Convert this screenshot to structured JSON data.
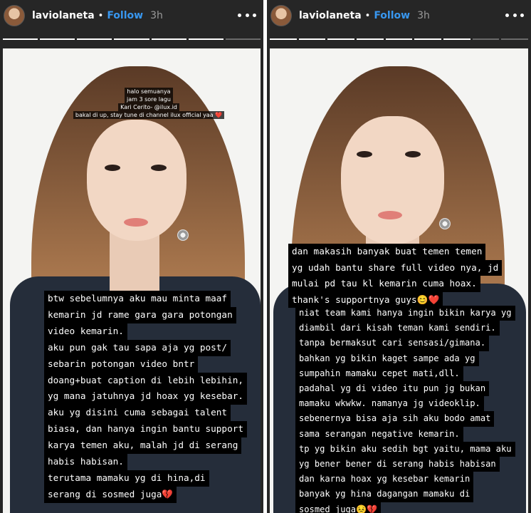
{
  "stories": [
    {
      "user": {
        "username": "laviolaneta",
        "follow_label": "Follow",
        "time": "3h"
      },
      "progress": {
        "total_segments": 7,
        "completed_segments": 6
      },
      "caption_lines": [
        "halo semuanya",
        "jam 3 sore lagu",
        "Kari Cerito- @ilux.id",
        "bakal di up, stay tune di channel ilux official yaa ❤️"
      ],
      "text_lines": [
        "btw sebelumnya aku mau minta maaf",
        "kemarin jd rame gara gara potongan",
        "video kemarin.",
        "aku pun gak tau sapa aja yg post/",
        "sebarin potongan video bntr",
        "doang+buat caption di lebih lebihin,",
        "yg mana jatuhnya jd hoax yg kesebar.",
        "aku yg disini cuma sebagai talent",
        "biasa, dan hanya ingin bantu support",
        "karya temen aku, malah jd di serang",
        "habis habisan.",
        "terutama mamaku yg di hina,di",
        "serang di sosmed juga💔"
      ]
    },
    {
      "user": {
        "username": "laviolaneta",
        "follow_label": "Follow",
        "time": "3h"
      },
      "progress": {
        "total_segments": 9,
        "completed_segments": 7
      },
      "text_lines_top": [
        "dan makasih banyak buat temen temen",
        "yg udah bantu share full video nya, jd",
        "mulai pd tau kl kemarin cuma hoax.",
        "thank's supportnya guys😊❤️"
      ],
      "text_lines": [
        "niat team kami hanya ingin bikin karya yg",
        "diambil dari kisah teman kami sendiri.",
        "tanpa bermaksut cari sensasi/gimana.",
        "bahkan yg bikin kaget sampe ada yg",
        "sumpahin mamaku cepet mati,dll.",
        "padahal yg di video itu pun jg bukan",
        "mamaku wkwkw. namanya jg videoklip.",
        "sebenernya bisa aja sih aku bodo amat",
        "sama serangan negative kemarin.",
        "tp yg bikin aku sedih bgt yaitu, mama aku",
        "yg bener bener di serang habis habisan",
        "dan karna hoax yg kesebar kemarin",
        "banyak yg hina dagangan mamaku di",
        "sosmed juga😣💔"
      ]
    }
  ]
}
